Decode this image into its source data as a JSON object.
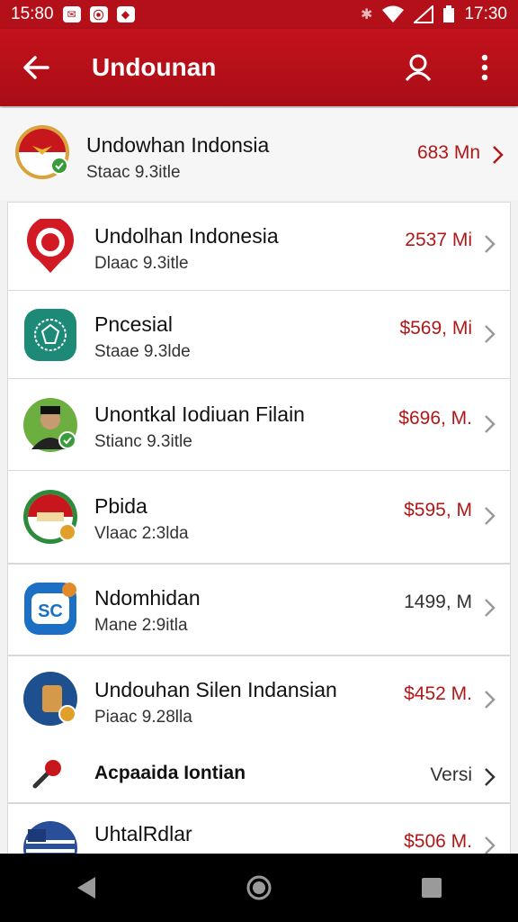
{
  "status": {
    "time": "15:80",
    "time_right": "17:30"
  },
  "appbar": {
    "title": "Undounan"
  },
  "items": [
    {
      "name": "Undowhan Indonsia",
      "sub": "Staac 9.3itle",
      "price": "683 Mn"
    },
    {
      "name": "Undolhan Indonesia",
      "sub": "Dlaac 9.3itle",
      "price": "2537 Mi"
    },
    {
      "name": "Pncesial",
      "sub": "Staae 9.3lde",
      "price": "$569, Mi"
    },
    {
      "name": "Unontkal Iodiuan Filain",
      "sub": "Stianc 9.3itle",
      "price": "$696, M."
    },
    {
      "name": "Pbida",
      "sub": "Vlaac 2:3lda",
      "price": "$595, M"
    },
    {
      "name": "Ndomhidan",
      "sub": "Mane 2:9itla",
      "price": "1499, M"
    },
    {
      "name": "Undouhan Silen Indansian",
      "sub": "Piaac 9.28lla",
      "price": "$452 M."
    },
    {
      "name": "Acpaaida Iontian",
      "price": "Versi"
    },
    {
      "name": "UhtalRdlar",
      "price": "$506 M."
    }
  ],
  "colors": {
    "brand": "#b3101a",
    "price": "#b01818"
  }
}
